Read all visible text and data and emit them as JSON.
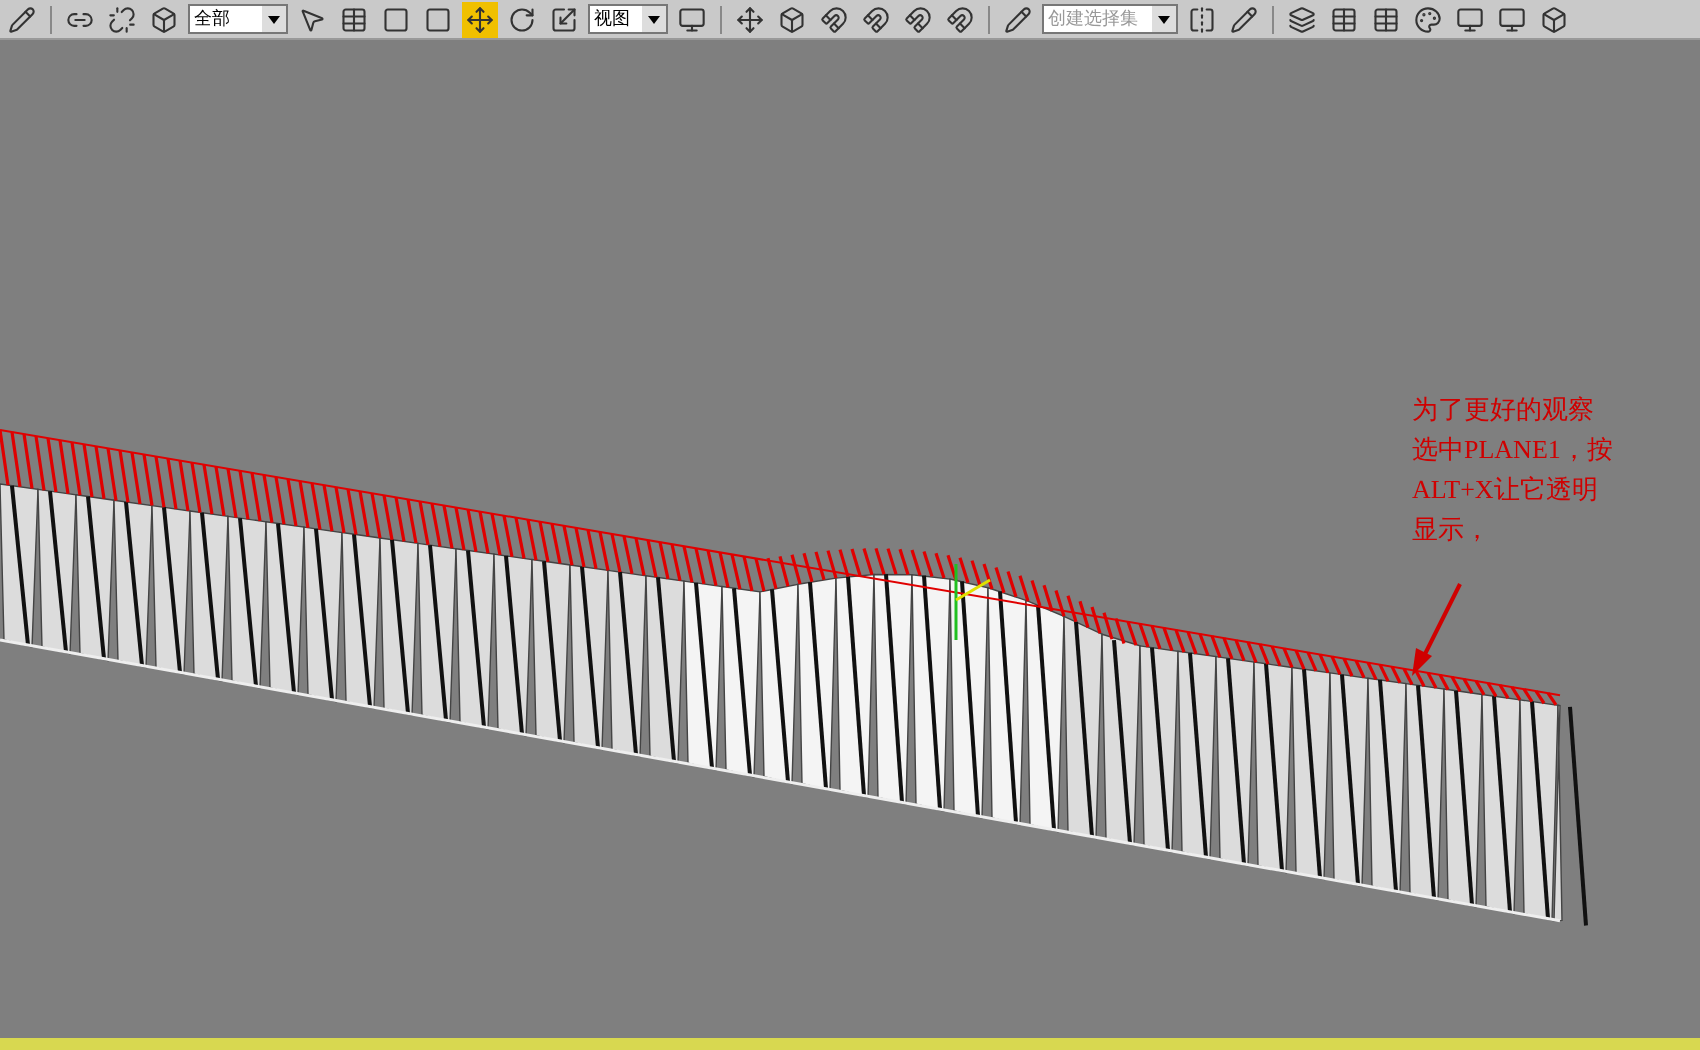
{
  "toolbar": {
    "selection_filter": "全部",
    "reference_coordinate": "视图",
    "named_selection_placeholder": "创建选择集"
  },
  "viewport": {
    "annotation": [
      "为了更好的观察",
      "选中PLANE1，按",
      "ALT+X让它透明",
      "显示，"
    ]
  }
}
